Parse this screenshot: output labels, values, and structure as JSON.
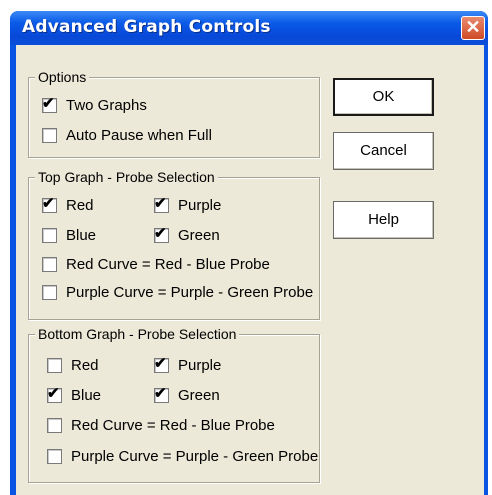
{
  "window": {
    "title": "Advanced Graph Controls",
    "close_glyph": "✕"
  },
  "options": {
    "title": "Options",
    "two_graphs": {
      "label": "Two Graphs",
      "checked": true
    },
    "auto_pause": {
      "label": "Auto Pause when Full",
      "checked": false
    }
  },
  "top_graph": {
    "title": "Top Graph - Probe Selection",
    "red": {
      "label": "Red",
      "checked": true
    },
    "purple": {
      "label": "Purple",
      "checked": true
    },
    "blue": {
      "label": "Blue",
      "checked": false
    },
    "green": {
      "label": "Green",
      "checked": true
    },
    "red_curve": {
      "label": "Red Curve = Red - Blue Probe",
      "checked": false
    },
    "purple_curve": {
      "label": "Purple Curve = Purple - Green Probe",
      "checked": false
    }
  },
  "bottom_graph": {
    "title": "Bottom Graph - Probe Selection",
    "red": {
      "label": "Red",
      "checked": false
    },
    "purple": {
      "label": "Purple",
      "checked": true
    },
    "blue": {
      "label": "Blue",
      "checked": true
    },
    "green": {
      "label": "Green",
      "checked": true
    },
    "red_curve": {
      "label": "Red Curve = Red - Blue Probe",
      "checked": false
    },
    "purple_curve": {
      "label": "Purple Curve = Purple - Green Probe",
      "checked": false
    }
  },
  "buttons": {
    "ok": "OK",
    "cancel": "Cancel",
    "help": "Help"
  },
  "checkmark": "✔"
}
